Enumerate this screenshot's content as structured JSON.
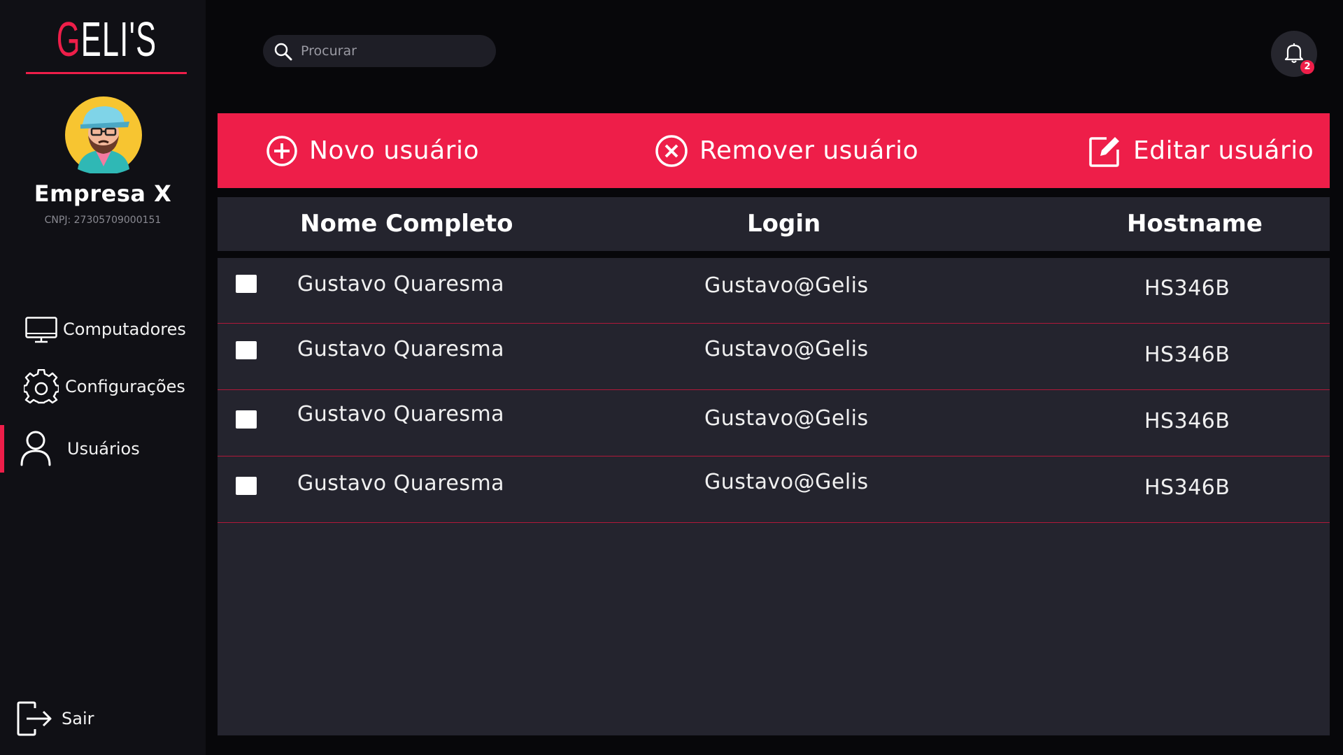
{
  "sidebar": {
    "logo_first": "G",
    "logo_rest": "ELI'S",
    "company_name": "Empresa X",
    "cnpj": "CNPJ: 27305709000151",
    "nav": [
      {
        "label": "Computadores",
        "icon": "monitor-icon",
        "active": false
      },
      {
        "label": "Configurações",
        "icon": "gear-icon",
        "active": false
      },
      {
        "label": "Usuários",
        "icon": "user-icon",
        "active": true
      }
    ],
    "logout_label": "Sair"
  },
  "header": {
    "search_placeholder": "Procurar",
    "notification_count": "2"
  },
  "actions": {
    "new_user": "Novo usuário",
    "remove_user": "Remover usuário",
    "edit_user": "Editar usuário"
  },
  "table": {
    "columns": [
      "Nome Completo",
      "Login",
      "Hostname"
    ],
    "rows": [
      {
        "name": "Gustavo Quaresma",
        "login": "Gustavo@Gelis",
        "hostname": "HS346B"
      },
      {
        "name": "Gustavo Quaresma",
        "login": "Gustavo@Gelis",
        "hostname": "HS346B"
      },
      {
        "name": "Gustavo Quaresma",
        "login": "Gustavo@Gelis",
        "hostname": "HS346B"
      },
      {
        "name": "Gustavo Quaresma",
        "login": "Gustavo@Gelis",
        "hostname": "HS346B"
      }
    ]
  },
  "colors": {
    "accent": "#ee1e49",
    "background": "#07070a",
    "sidebar": "#101015",
    "panel": "#24242e"
  }
}
